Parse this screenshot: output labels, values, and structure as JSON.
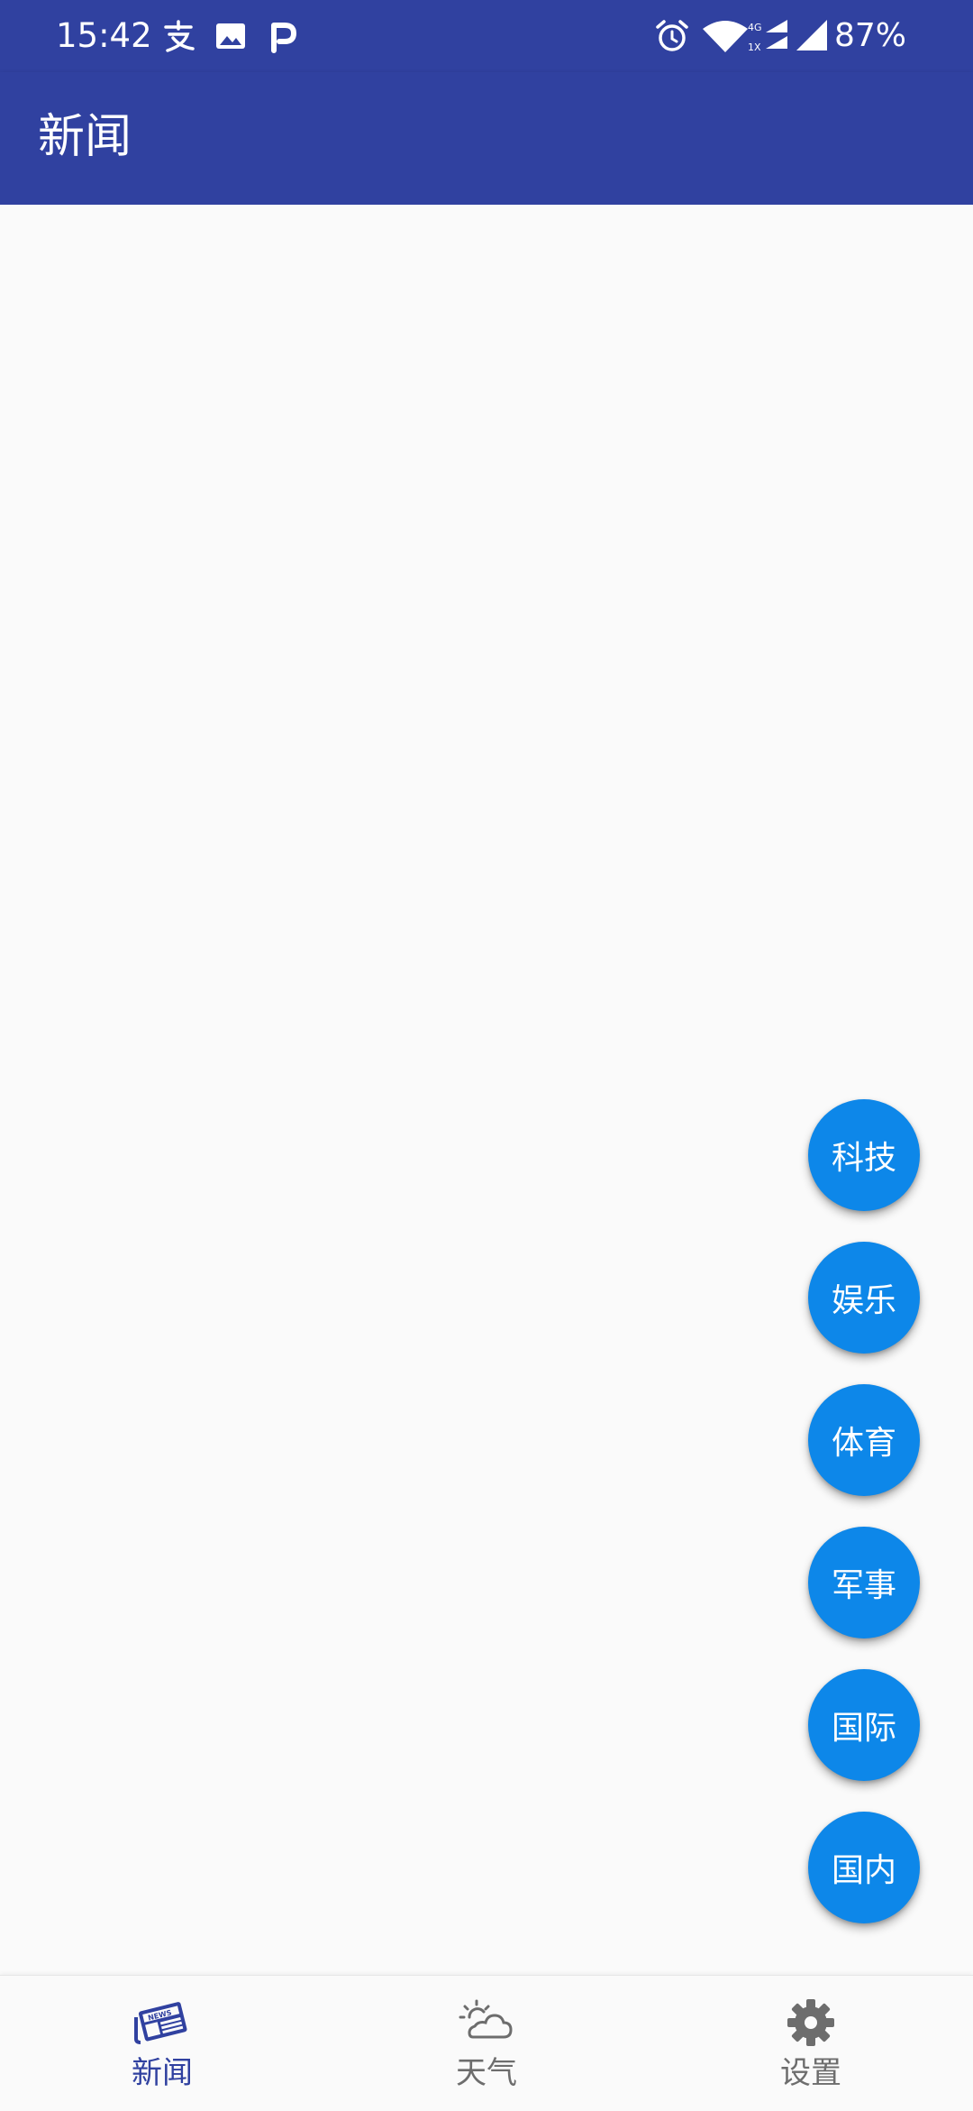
{
  "status_bar": {
    "time": "15:42",
    "battery": "87%",
    "network_top": "4G",
    "network_bottom": "1X",
    "icons": [
      "alipay-icon",
      "image-icon",
      "parking-app-icon",
      "alarm-icon",
      "wifi-icon",
      "cellular-signal-icon",
      "cellular-signal-icon"
    ]
  },
  "app_bar": {
    "title": "新闻"
  },
  "fabs": [
    {
      "label": "科技"
    },
    {
      "label": "娱乐"
    },
    {
      "label": "体育"
    },
    {
      "label": "军事"
    },
    {
      "label": "国际"
    },
    {
      "label": "国内"
    }
  ],
  "bottom_nav": {
    "items": [
      {
        "label": "新闻",
        "icon": "newspaper-icon",
        "active": true
      },
      {
        "label": "天气",
        "icon": "weather-icon",
        "active": false
      },
      {
        "label": "设置",
        "icon": "gear-icon",
        "active": false
      }
    ]
  },
  "colors": {
    "primary": "#3041a0",
    "fab": "#0d87e9",
    "background": "#fafafa",
    "inactive": "#6d6d6d"
  }
}
